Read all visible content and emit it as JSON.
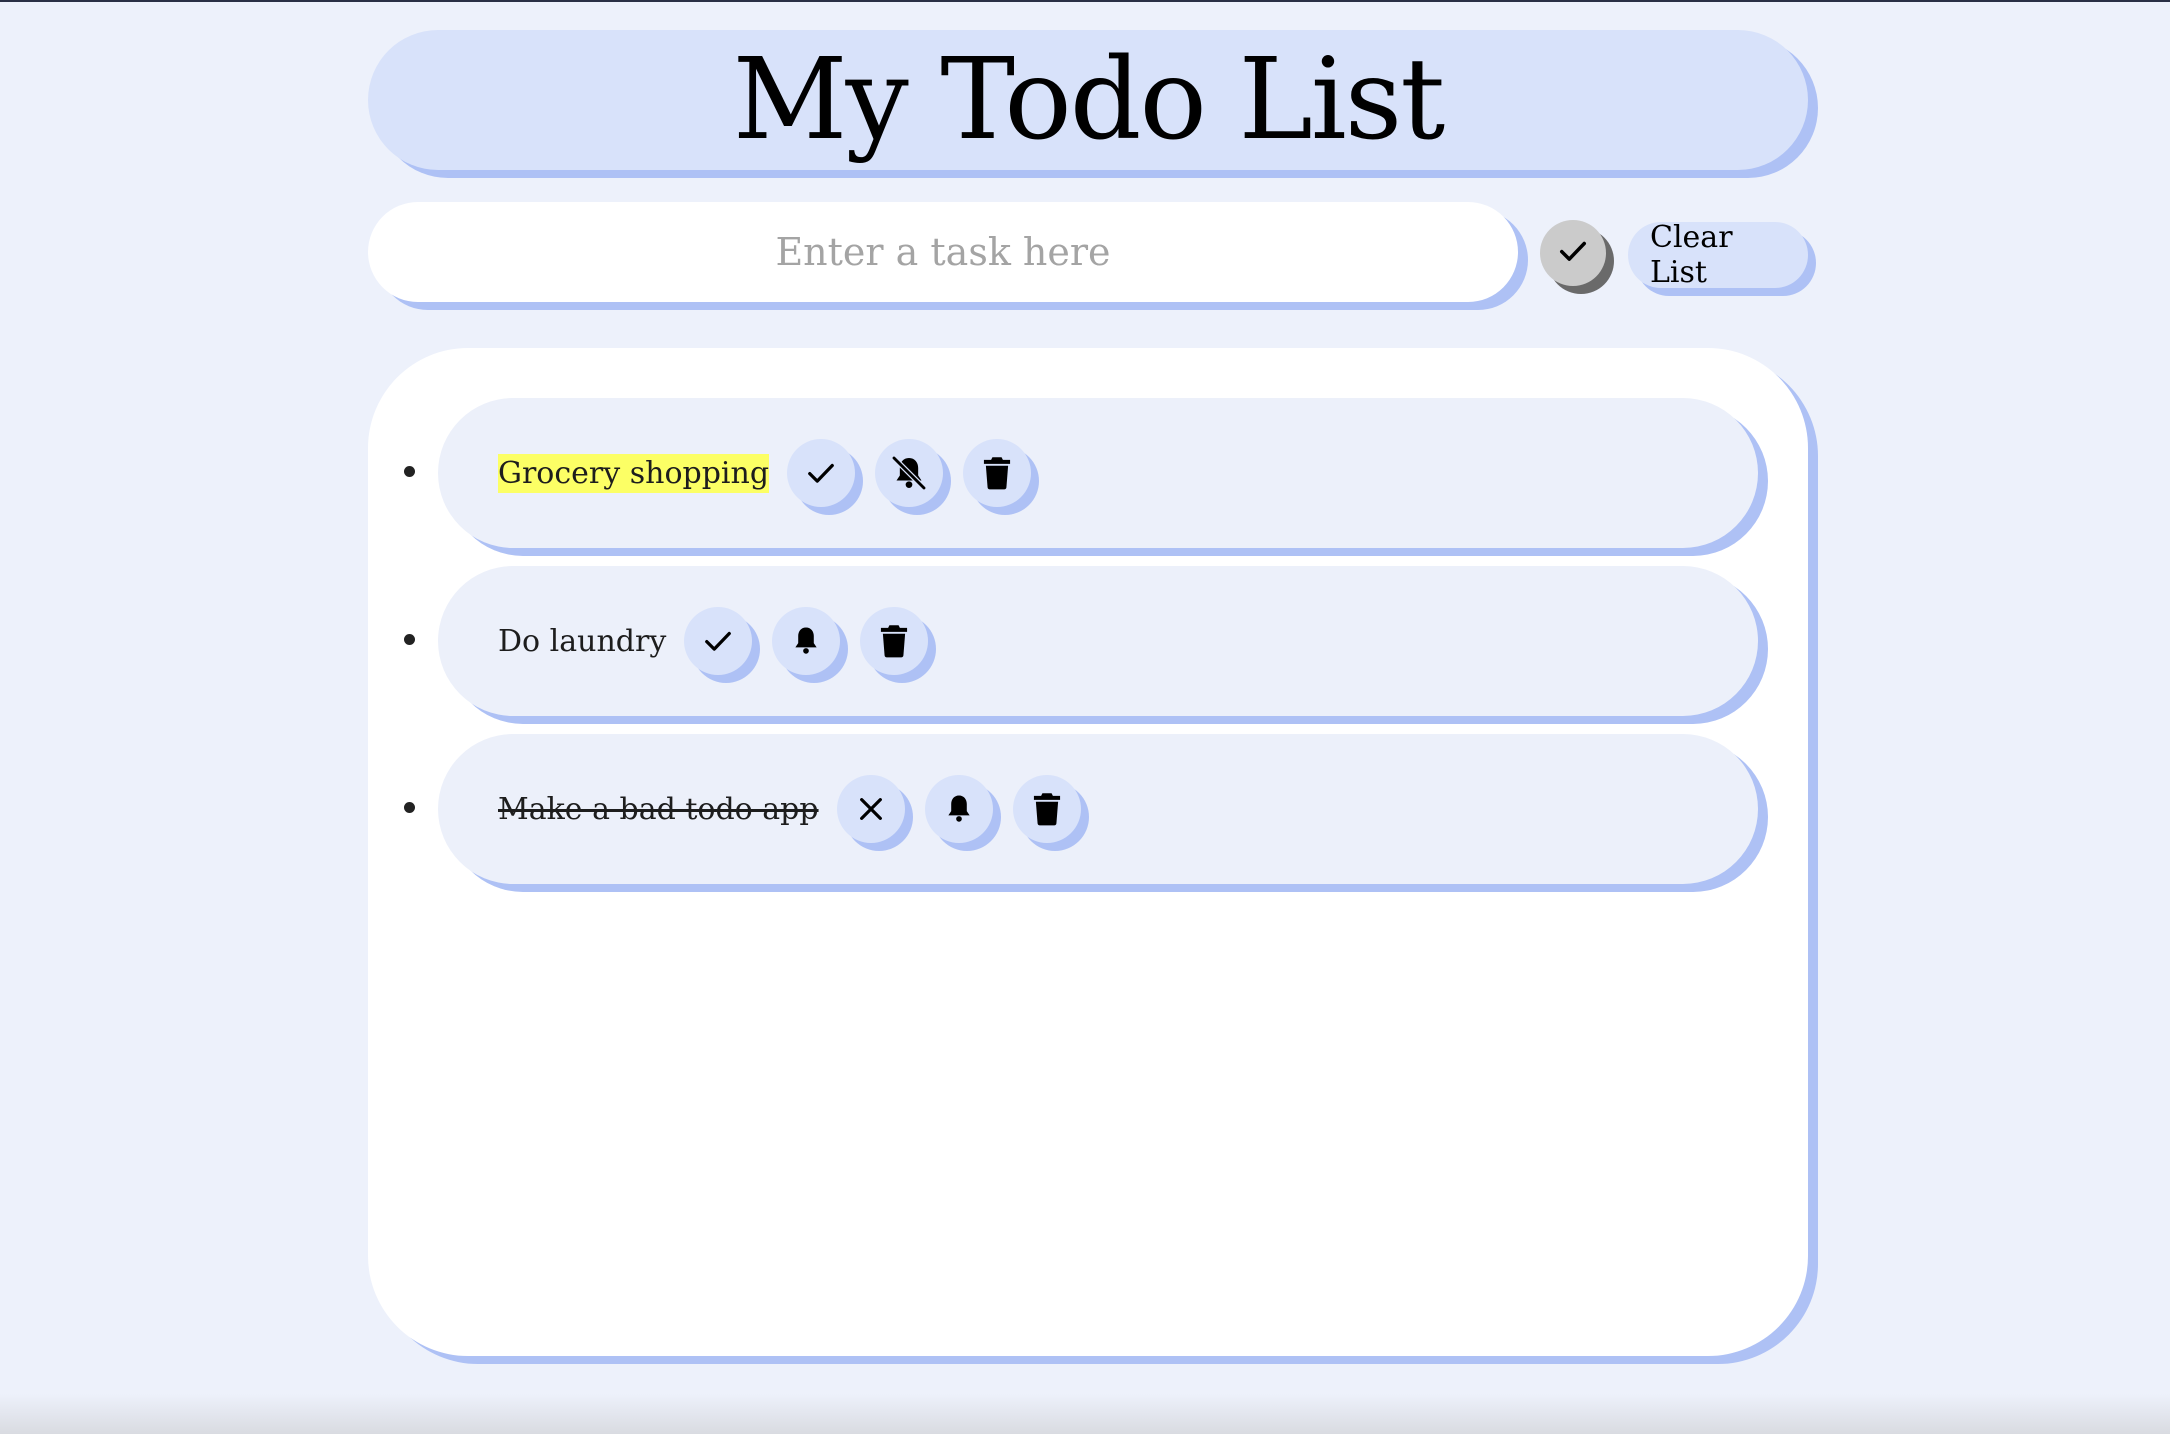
{
  "header": {
    "title": "My Todo List"
  },
  "input": {
    "placeholder": "Enter a task here",
    "value": ""
  },
  "actions": {
    "add_icon": "check-icon",
    "clear_label": "Clear List"
  },
  "todos": [
    {
      "text": "Grocery shopping",
      "highlighted": true,
      "completed": false,
      "reminder": "off",
      "toggle_icon": "check-icon",
      "reminder_icon": "bell-slash-icon",
      "delete_icon": "trash-icon"
    },
    {
      "text": "Do laundry",
      "highlighted": false,
      "completed": false,
      "reminder": "on",
      "toggle_icon": "check-icon",
      "reminder_icon": "bell-icon",
      "delete_icon": "trash-icon"
    },
    {
      "text": "Make a bad todo app",
      "highlighted": false,
      "completed": true,
      "reminder": "on",
      "toggle_icon": "x-icon",
      "reminder_icon": "bell-icon",
      "delete_icon": "trash-icon"
    }
  ],
  "colors": {
    "background": "#edf1fb",
    "accent": "#d8e2fa",
    "shadow": "#aec1f5",
    "highlight": "#fcff65",
    "add_button": "#cbcbcb"
  }
}
